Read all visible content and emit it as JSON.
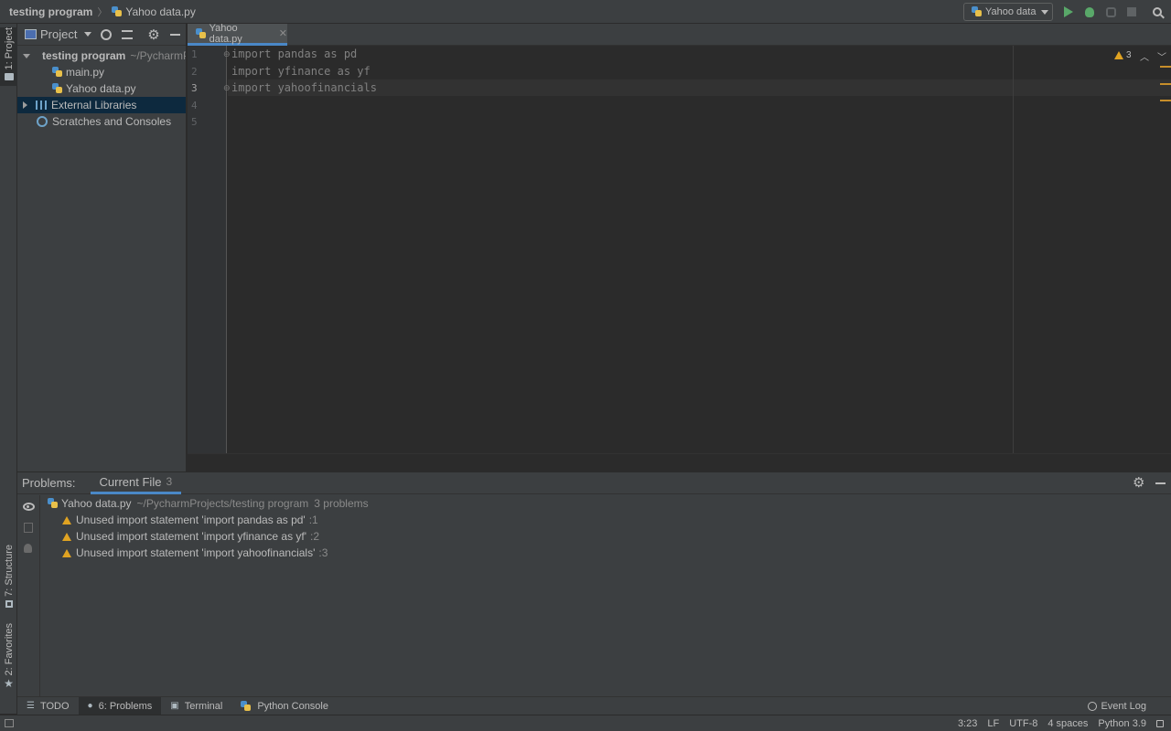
{
  "navbar": {
    "project": "testing program",
    "file": "Yahoo data.py",
    "run_config": "Yahoo data"
  },
  "left_stripe": {
    "project_tab": "1: Project",
    "structure_tab": "7: Structure",
    "favorites_tab": "2: Favorites"
  },
  "project_panel": {
    "title": "Project",
    "root_name": "testing program",
    "root_path": "~/PycharmProjects/testing program",
    "files": [
      "main.py",
      "Yahoo data.py"
    ],
    "external_libraries": "External Libraries",
    "scratches": "Scratches and Consoles"
  },
  "editor": {
    "tab_label": "Yahoo data.py",
    "line_numbers": [
      "1",
      "2",
      "3",
      "4",
      "5"
    ],
    "lines": [
      "import pandas as pd",
      "import yfinance as yf",
      "import yahoofinancials",
      "",
      ""
    ],
    "current_line": 3,
    "warning_count": "3"
  },
  "problems": {
    "label": "Problems:",
    "tab": "Current File",
    "tab_count": "3",
    "file": "Yahoo data.py",
    "file_path": "~/PycharmProjects/testing program",
    "file_summary": "3 problems",
    "items": [
      {
        "text": "Unused import statement 'import pandas as pd'",
        "line": ":1"
      },
      {
        "text": "Unused import statement 'import yfinance as yf'",
        "line": ":2"
      },
      {
        "text": "Unused import statement 'import yahoofinancials'",
        "line": ":3"
      }
    ]
  },
  "toolwindows": {
    "todo": "TODO",
    "problems": "6: Problems",
    "terminal": "Terminal",
    "python_console": "Python Console",
    "event_log": "Event Log"
  },
  "status": {
    "position": "3:23",
    "line_sep": "LF",
    "encoding": "UTF-8",
    "indent": "4 spaces",
    "interpreter": "Python 3.9"
  },
  "colors": {
    "accent": "#4a88c7",
    "warning": "#e0a322",
    "run": "#59a869"
  }
}
